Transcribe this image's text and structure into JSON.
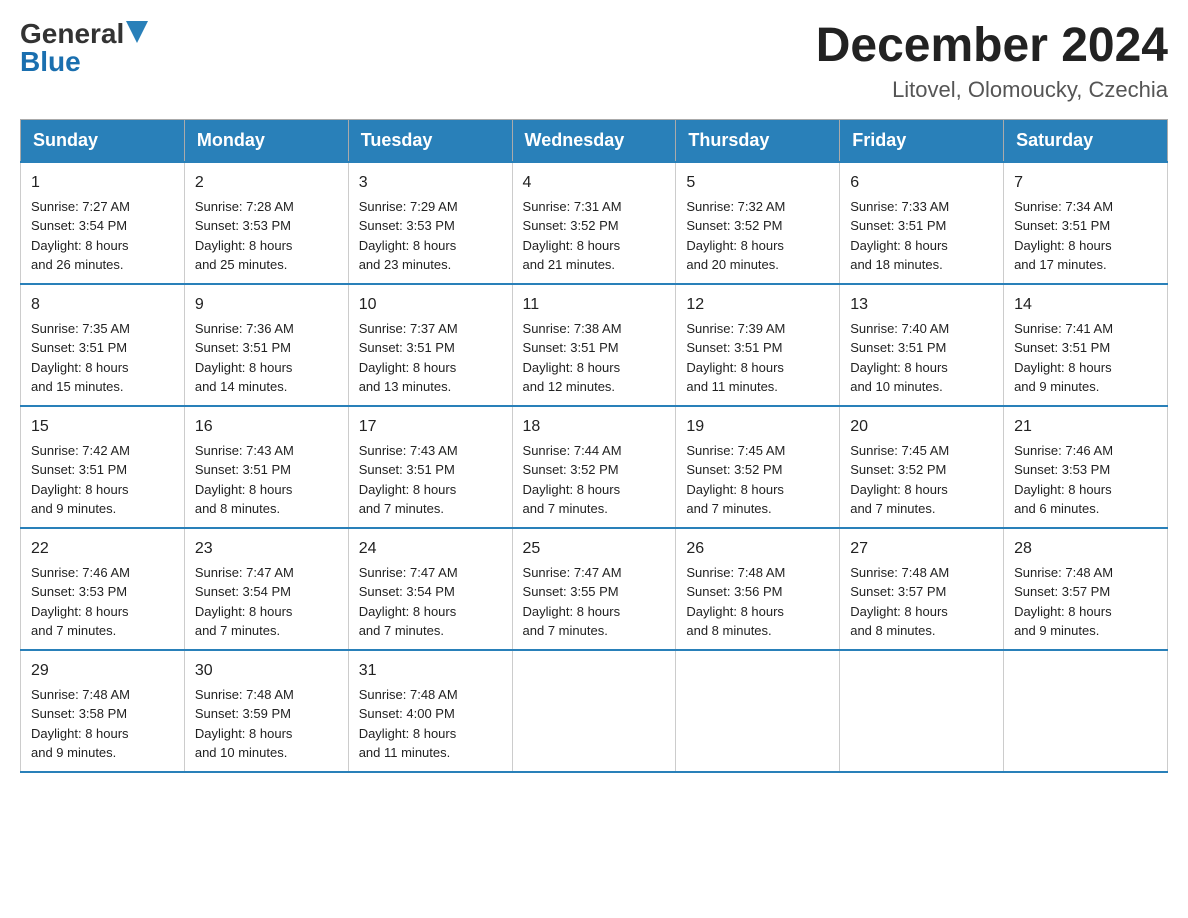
{
  "header": {
    "logo_general": "General",
    "logo_blue": "Blue",
    "month_title": "December 2024",
    "location": "Litovel, Olomoucky, Czechia"
  },
  "weekdays": [
    "Sunday",
    "Monday",
    "Tuesday",
    "Wednesday",
    "Thursday",
    "Friday",
    "Saturday"
  ],
  "weeks": [
    [
      {
        "day": "1",
        "info": "Sunrise: 7:27 AM\nSunset: 3:54 PM\nDaylight: 8 hours\nand 26 minutes."
      },
      {
        "day": "2",
        "info": "Sunrise: 7:28 AM\nSunset: 3:53 PM\nDaylight: 8 hours\nand 25 minutes."
      },
      {
        "day": "3",
        "info": "Sunrise: 7:29 AM\nSunset: 3:53 PM\nDaylight: 8 hours\nand 23 minutes."
      },
      {
        "day": "4",
        "info": "Sunrise: 7:31 AM\nSunset: 3:52 PM\nDaylight: 8 hours\nand 21 minutes."
      },
      {
        "day": "5",
        "info": "Sunrise: 7:32 AM\nSunset: 3:52 PM\nDaylight: 8 hours\nand 20 minutes."
      },
      {
        "day": "6",
        "info": "Sunrise: 7:33 AM\nSunset: 3:51 PM\nDaylight: 8 hours\nand 18 minutes."
      },
      {
        "day": "7",
        "info": "Sunrise: 7:34 AM\nSunset: 3:51 PM\nDaylight: 8 hours\nand 17 minutes."
      }
    ],
    [
      {
        "day": "8",
        "info": "Sunrise: 7:35 AM\nSunset: 3:51 PM\nDaylight: 8 hours\nand 15 minutes."
      },
      {
        "day": "9",
        "info": "Sunrise: 7:36 AM\nSunset: 3:51 PM\nDaylight: 8 hours\nand 14 minutes."
      },
      {
        "day": "10",
        "info": "Sunrise: 7:37 AM\nSunset: 3:51 PM\nDaylight: 8 hours\nand 13 minutes."
      },
      {
        "day": "11",
        "info": "Sunrise: 7:38 AM\nSunset: 3:51 PM\nDaylight: 8 hours\nand 12 minutes."
      },
      {
        "day": "12",
        "info": "Sunrise: 7:39 AM\nSunset: 3:51 PM\nDaylight: 8 hours\nand 11 minutes."
      },
      {
        "day": "13",
        "info": "Sunrise: 7:40 AM\nSunset: 3:51 PM\nDaylight: 8 hours\nand 10 minutes."
      },
      {
        "day": "14",
        "info": "Sunrise: 7:41 AM\nSunset: 3:51 PM\nDaylight: 8 hours\nand 9 minutes."
      }
    ],
    [
      {
        "day": "15",
        "info": "Sunrise: 7:42 AM\nSunset: 3:51 PM\nDaylight: 8 hours\nand 9 minutes."
      },
      {
        "day": "16",
        "info": "Sunrise: 7:43 AM\nSunset: 3:51 PM\nDaylight: 8 hours\nand 8 minutes."
      },
      {
        "day": "17",
        "info": "Sunrise: 7:43 AM\nSunset: 3:51 PM\nDaylight: 8 hours\nand 7 minutes."
      },
      {
        "day": "18",
        "info": "Sunrise: 7:44 AM\nSunset: 3:52 PM\nDaylight: 8 hours\nand 7 minutes."
      },
      {
        "day": "19",
        "info": "Sunrise: 7:45 AM\nSunset: 3:52 PM\nDaylight: 8 hours\nand 7 minutes."
      },
      {
        "day": "20",
        "info": "Sunrise: 7:45 AM\nSunset: 3:52 PM\nDaylight: 8 hours\nand 7 minutes."
      },
      {
        "day": "21",
        "info": "Sunrise: 7:46 AM\nSunset: 3:53 PM\nDaylight: 8 hours\nand 6 minutes."
      }
    ],
    [
      {
        "day": "22",
        "info": "Sunrise: 7:46 AM\nSunset: 3:53 PM\nDaylight: 8 hours\nand 7 minutes."
      },
      {
        "day": "23",
        "info": "Sunrise: 7:47 AM\nSunset: 3:54 PM\nDaylight: 8 hours\nand 7 minutes."
      },
      {
        "day": "24",
        "info": "Sunrise: 7:47 AM\nSunset: 3:54 PM\nDaylight: 8 hours\nand 7 minutes."
      },
      {
        "day": "25",
        "info": "Sunrise: 7:47 AM\nSunset: 3:55 PM\nDaylight: 8 hours\nand 7 minutes."
      },
      {
        "day": "26",
        "info": "Sunrise: 7:48 AM\nSunset: 3:56 PM\nDaylight: 8 hours\nand 8 minutes."
      },
      {
        "day": "27",
        "info": "Sunrise: 7:48 AM\nSunset: 3:57 PM\nDaylight: 8 hours\nand 8 minutes."
      },
      {
        "day": "28",
        "info": "Sunrise: 7:48 AM\nSunset: 3:57 PM\nDaylight: 8 hours\nand 9 minutes."
      }
    ],
    [
      {
        "day": "29",
        "info": "Sunrise: 7:48 AM\nSunset: 3:58 PM\nDaylight: 8 hours\nand 9 minutes."
      },
      {
        "day": "30",
        "info": "Sunrise: 7:48 AM\nSunset: 3:59 PM\nDaylight: 8 hours\nand 10 minutes."
      },
      {
        "day": "31",
        "info": "Sunrise: 7:48 AM\nSunset: 4:00 PM\nDaylight: 8 hours\nand 11 minutes."
      },
      {
        "day": "",
        "info": ""
      },
      {
        "day": "",
        "info": ""
      },
      {
        "day": "",
        "info": ""
      },
      {
        "day": "",
        "info": ""
      }
    ]
  ]
}
